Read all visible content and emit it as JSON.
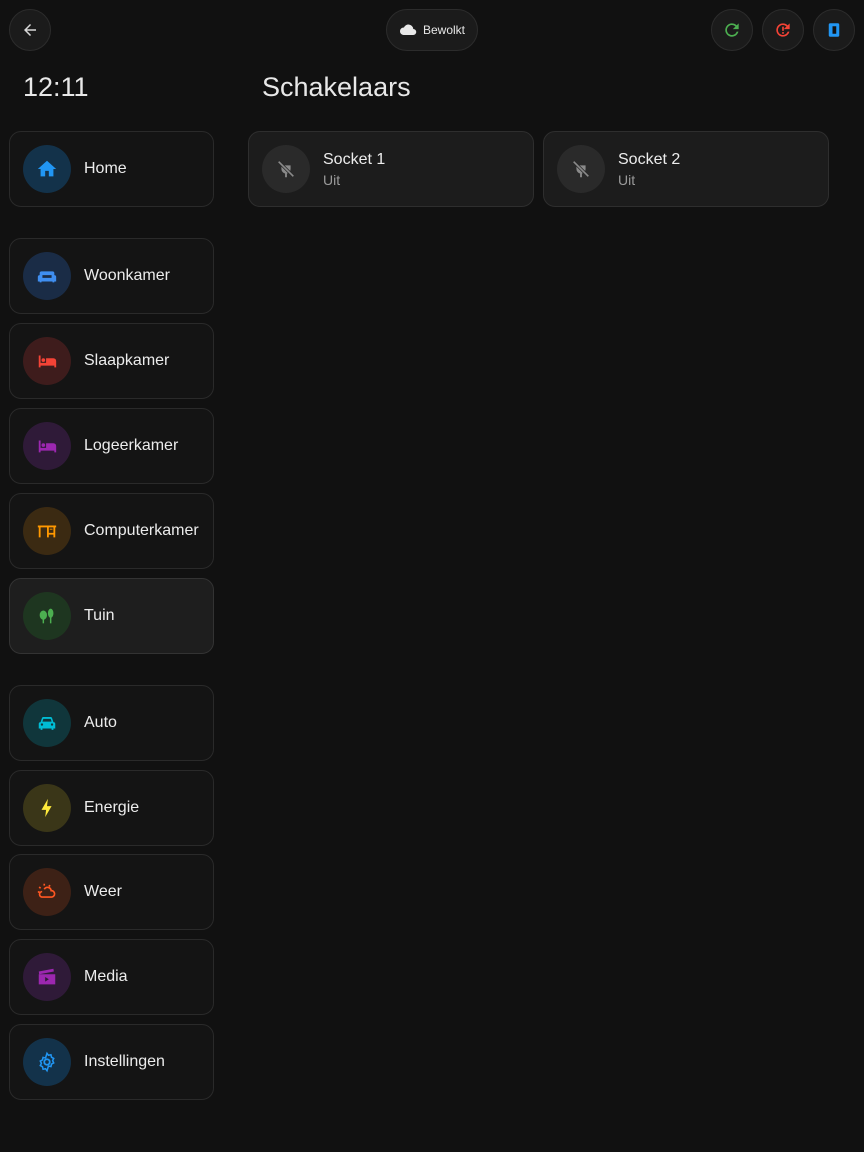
{
  "header": {
    "back_icon": "arrow-left-icon",
    "weather_label": "Bewolkt",
    "weather_icon": "cloud-icon",
    "actions": [
      {
        "name": "refresh",
        "icon": "refresh-icon",
        "color": "#4caf50"
      },
      {
        "name": "restart",
        "icon": "alert-restart-icon",
        "color": "#f44336"
      },
      {
        "name": "sidebar-toggle",
        "icon": "sidebar-icon",
        "color": "#2196f3"
      }
    ]
  },
  "clock": "12:11",
  "page_title": "Schakelaars",
  "nav": [
    {
      "label": "Home",
      "icon": "home-icon",
      "color": "#2196f3",
      "bg": "#13324a"
    },
    {
      "label": "Woonkamer",
      "icon": "sofa-icon",
      "color": "#3f8ef0",
      "bg": "#1a2c46"
    },
    {
      "label": "Slaapkamer",
      "icon": "bed-icon",
      "color": "#f44336",
      "bg": "#3e1c1c"
    },
    {
      "label": "Logeerkamer",
      "icon": "bed-icon",
      "color": "#9c27b0",
      "bg": "#2f1a38"
    },
    {
      "label": "Computerkamer",
      "icon": "desk-icon",
      "color": "#ff9800",
      "bg": "#3b2a12"
    },
    {
      "label": "Tuin",
      "icon": "tree-icon",
      "color": "#4caf50",
      "bg": "#1e3620"
    },
    {
      "label": "Auto",
      "icon": "car-icon",
      "color": "#00bcd4",
      "bg": "#10363b"
    },
    {
      "label": "Energie",
      "icon": "lightning-icon",
      "color": "#ffeb3b",
      "bg": "#3a3618"
    },
    {
      "label": "Weer",
      "icon": "weather-sunset-icon",
      "color": "#ff5722",
      "bg": "#3d2116"
    },
    {
      "label": "Media",
      "icon": "movie-icon",
      "color": "#9c27b0",
      "bg": "#2f1a38"
    },
    {
      "label": "Instellingen",
      "icon": "gear-icon",
      "color": "#2196f3",
      "bg": "#13324a"
    }
  ],
  "active_nav": "Tuin",
  "switches": [
    {
      "name": "Socket 1",
      "state": "Uit",
      "icon": "power-plug-off-icon"
    },
    {
      "name": "Socket 2",
      "state": "Uit",
      "icon": "power-plug-off-icon"
    }
  ]
}
